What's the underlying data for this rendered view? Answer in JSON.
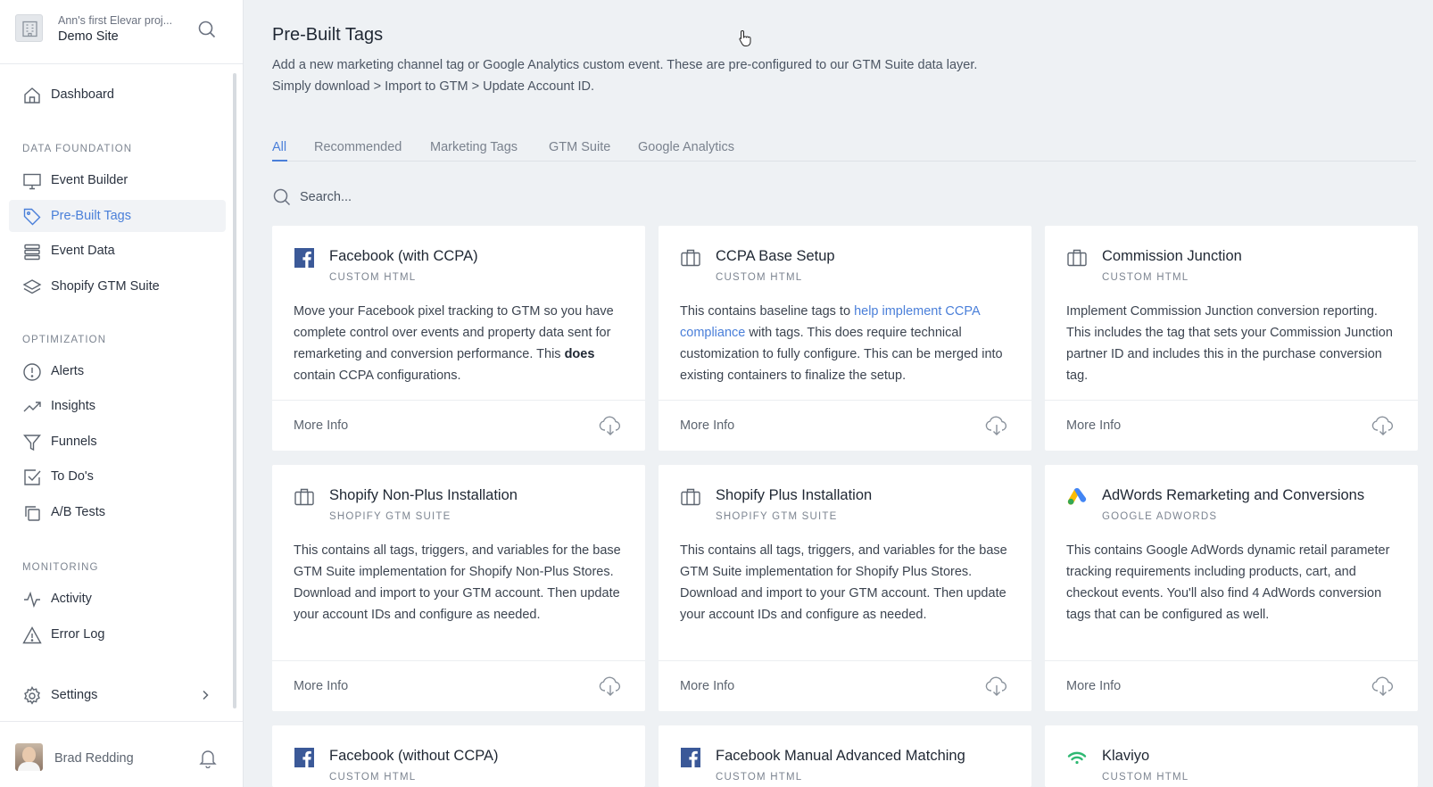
{
  "project": {
    "subtitle": "Ann's first Elevar proj...",
    "name": "Demo Site"
  },
  "nav": {
    "dashboard": "Dashboard",
    "section_data": "DATA FOUNDATION",
    "event_builder": "Event Builder",
    "prebuilt_tags": "Pre-Built Tags",
    "event_data": "Event Data",
    "shopify_gtm": "Shopify GTM Suite",
    "section_opt": "OPTIMIZATION",
    "alerts": "Alerts",
    "insights": "Insights",
    "funnels": "Funnels",
    "todos": "To Do's",
    "ab_tests": "A/B Tests",
    "section_mon": "MONITORING",
    "activity": "Activity",
    "error_log": "Error Log",
    "settings": "Settings"
  },
  "user": {
    "name": "Brad Redding"
  },
  "page": {
    "title": "Pre-Built Tags",
    "description": "Add a new marketing channel tag or Google Analytics custom event. These are pre-configured to our GTM Suite data layer. Simply download > Import to GTM > Update Account ID."
  },
  "tabs": [
    "All",
    "Recommended",
    "Marketing Tags",
    "GTM Suite",
    "Google Analytics"
  ],
  "search": {
    "placeholder": "Search..."
  },
  "more_info_label": "More Info",
  "cards": [
    {
      "icon": "facebook-icon",
      "title": "Facebook (with CCPA)",
      "type": "CUSTOM HTML",
      "desc_a": "Move your Facebook pixel tracking to GTM so you have complete control over events and property data sent for remarketing and conversion performance. This ",
      "desc_bold": "does",
      "desc_b": " contain CCPA configurations."
    },
    {
      "icon": "briefcase-icon",
      "title": "CCPA Base Setup",
      "type": "CUSTOM HTML",
      "desc_a": "This contains baseline tags to ",
      "desc_link": "help implement CCPA compliance",
      "desc_b": " with tags. This does require technical customization to fully configure. This can be merged into existing containers to finalize the setup."
    },
    {
      "icon": "briefcase-icon",
      "title": "Commission Junction",
      "type": "CUSTOM HTML",
      "desc": "Implement Commission Junction conversion reporting. This includes the tag that sets your Commission Junction partner ID and includes this in the purchase conversion tag."
    },
    {
      "icon": "briefcase-icon",
      "title": "Shopify Non-Plus Installation",
      "type": "SHOPIFY GTM SUITE",
      "desc": "This contains all tags, triggers, and variables for the base GTM Suite implementation for Shopify Non-Plus Stores. Download and import to your GTM account. Then update your account IDs and configure as needed."
    },
    {
      "icon": "briefcase-icon",
      "title": "Shopify Plus Installation",
      "type": "SHOPIFY GTM SUITE",
      "desc": "This contains all tags, triggers, and variables for the base GTM Suite implementation for Shopify Plus Stores. Download and import to your GTM account. Then update your account IDs and configure as needed."
    },
    {
      "icon": "google-ads-icon",
      "title": "AdWords Remarketing and Conversions",
      "type": "GOOGLE ADWORDS",
      "desc": "This contains Google AdWords dynamic retail parameter tracking requirements including products, cart, and checkout events. You'll also find 4 AdWords conversion tags that can be configured as well."
    },
    {
      "icon": "facebook-icon",
      "title": "Facebook (without CCPA)",
      "type": "CUSTOM HTML"
    },
    {
      "icon": "facebook-icon",
      "title": "Facebook Manual Advanced Matching",
      "type": "CUSTOM HTML"
    },
    {
      "icon": "klaviyo-icon",
      "title": "Klaviyo",
      "type": "CUSTOM HTML"
    }
  ],
  "colors": {
    "accent": "#4a7fd9",
    "facebook": "#3b5998",
    "klaviyo": "#2eb872",
    "google_blue": "#4285f4",
    "google_yellow": "#fbbc04",
    "google_green": "#34a853"
  }
}
